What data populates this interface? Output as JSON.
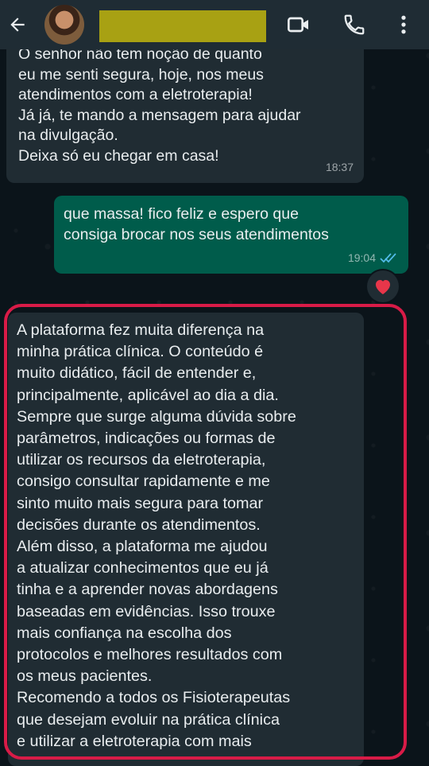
{
  "header": {
    "contact_name": "",
    "icons": [
      "back-arrow-icon",
      "video-call-icon",
      "phone-icon",
      "more-options-icon"
    ]
  },
  "messages": [
    {
      "direction": "incoming",
      "text": "O senhor não tem noção de quanto\neu me senti segura, hoje, nos meus\natendimentos com a eletroterapia!\nJá já, te mando a mensagem para ajudar\nna divulgação.\nDeixa só eu chegar em casa!",
      "time": "18:37"
    },
    {
      "direction": "outgoing",
      "text": "que massa! fico feliz e espero que\nconsiga brocar nos seus atendimentos",
      "time": "19:04",
      "status": "read",
      "reaction": "heart"
    },
    {
      "direction": "incoming",
      "highlighted": true,
      "text": "A plataforma fez muita diferença na\nminha prática clínica. O conteúdo é\nmuito didático, fácil de entender e,\nprincipalmente, aplicável ao dia a dia.\nSempre que surge alguma dúvida sobre\nparâmetros, indicações ou formas de\nutilizar os recursos da eletroterapia,\nconsigo consultar rapidamente e me\nsinto muito mais segura para tomar\ndecisões durante os atendimentos.\nAlém disso, a plataforma me ajudou\na atualizar conhecimentos que eu já\ntinha e a aprender novas abordagens\nbaseadas em evidências. Isso trouxe\nmais confiança na escolha dos\nprotocolos e melhores resultados com\nos meus pacientes.\nRecomendo a todos os Fisioterapeutas\nque desejam evoluir na prática clínica\ne utilizar a eletroterapia com mais"
    }
  ],
  "colors": {
    "header_bg": "#1f2c34",
    "incoming_bubble": "#202c33",
    "outgoing_bubble": "#005c4b",
    "read_ticks": "#53bdeb",
    "highlight_border": "#d81b47",
    "name_redaction": "#a8a113"
  }
}
